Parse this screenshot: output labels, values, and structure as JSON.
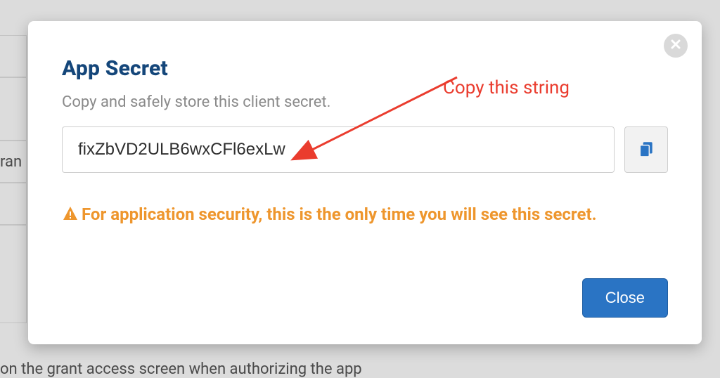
{
  "modal": {
    "title": "App Secret",
    "subtitle": "Copy and safely store this client secret.",
    "secret_value": "fixZbVD2ULB6wxCFl6exLw",
    "warning_text": "For application security, this is the only time you will see this secret.",
    "close_button_label": "Close"
  },
  "annotation": {
    "label": "Copy this string"
  },
  "background": {
    "partial_left_word": "ran",
    "partial_bottom_line": "on the grant access screen when authorizing the app"
  },
  "colors": {
    "title": "#14467a",
    "warning": "#ee962d",
    "primary_button": "#2a74c4",
    "annotation": "#ea3c2e"
  }
}
